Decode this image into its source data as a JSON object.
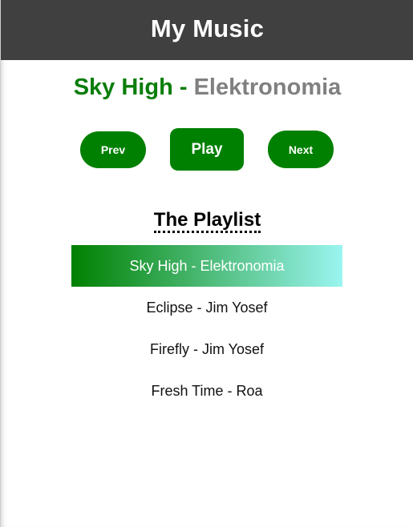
{
  "app": {
    "title": "My Music"
  },
  "now_playing": {
    "song": "Sky High",
    "separator": " - ",
    "artist": "Elektronomia"
  },
  "controls": {
    "prev_label": "Prev",
    "play_label": "Play",
    "next_label": "Next"
  },
  "playlist": {
    "title": "The Playlist",
    "active_index": 0,
    "items": [
      {
        "label": "Sky High - Elektronomia"
      },
      {
        "label": "Eclipse - Jim Yosef"
      },
      {
        "label": "Firefly - Jim Yosef"
      },
      {
        "label": "Fresh Time - Roa"
      }
    ]
  },
  "colors": {
    "header_bg": "#404040",
    "accent_green": "#008000",
    "artist_gray": "#808080",
    "active_gradient_end": "#9af5f0"
  }
}
